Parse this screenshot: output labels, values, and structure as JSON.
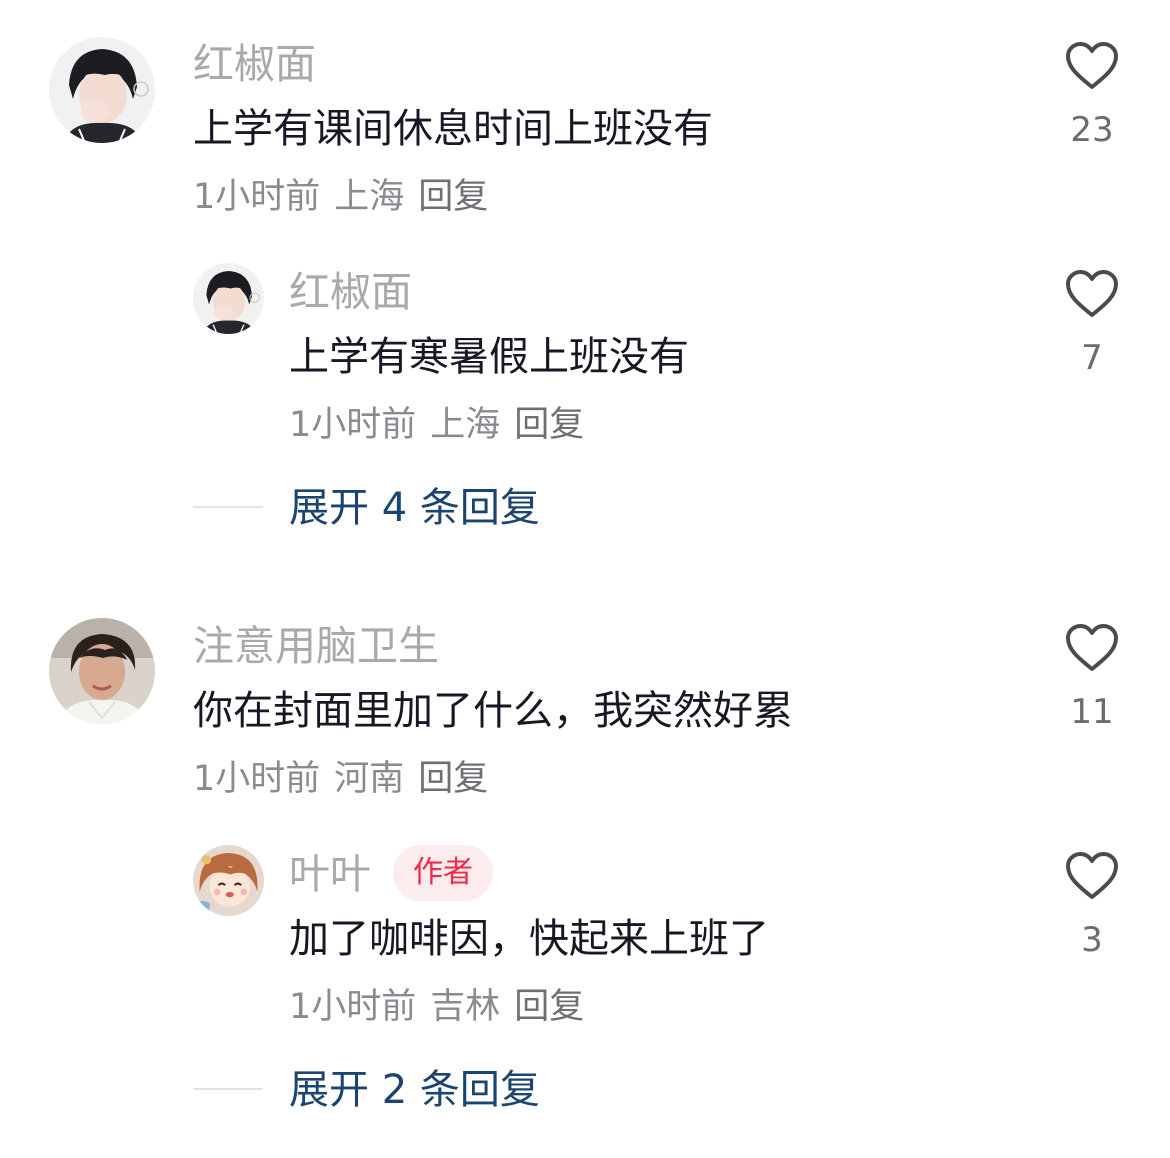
{
  "comments": [
    {
      "username": "红椒面",
      "text": "上学有课间休息时间上班没有",
      "time": "1小时前",
      "location": "上海",
      "reply": "回复",
      "likes": "23",
      "avatar_icon": "anime-boy-avatar",
      "replies": [
        {
          "username": "红椒面",
          "text": "上学有寒暑假上班没有",
          "time": "1小时前",
          "location": "上海",
          "reply": "回复",
          "likes": "7",
          "avatar_icon": "anime-boy-avatar"
        }
      ],
      "expand": "展开 4 条回复"
    },
    {
      "username": "注意用脑卫生",
      "text": "你在封面里加了什么，我突然好累",
      "time": "1小时前",
      "location": "河南",
      "reply": "回复",
      "likes": "11",
      "avatar_icon": "woman-photo-avatar",
      "replies": [
        {
          "username": "叶叶",
          "badge": "作者",
          "text": "加了咖啡因，快起来上班了",
          "time": "1小时前",
          "location": "吉林",
          "reply": "回复",
          "likes": "3",
          "avatar_icon": "cartoon-girl-avatar"
        }
      ],
      "expand": "展开 2 条回复"
    }
  ],
  "colors": {
    "username": "#a8a8ad",
    "text": "#161823",
    "meta": "#8a8b91",
    "expand": "#1c4470",
    "badge_bg": "#fdecee",
    "badge_text": "#ef2a4b",
    "heart": "#4a4b52"
  }
}
